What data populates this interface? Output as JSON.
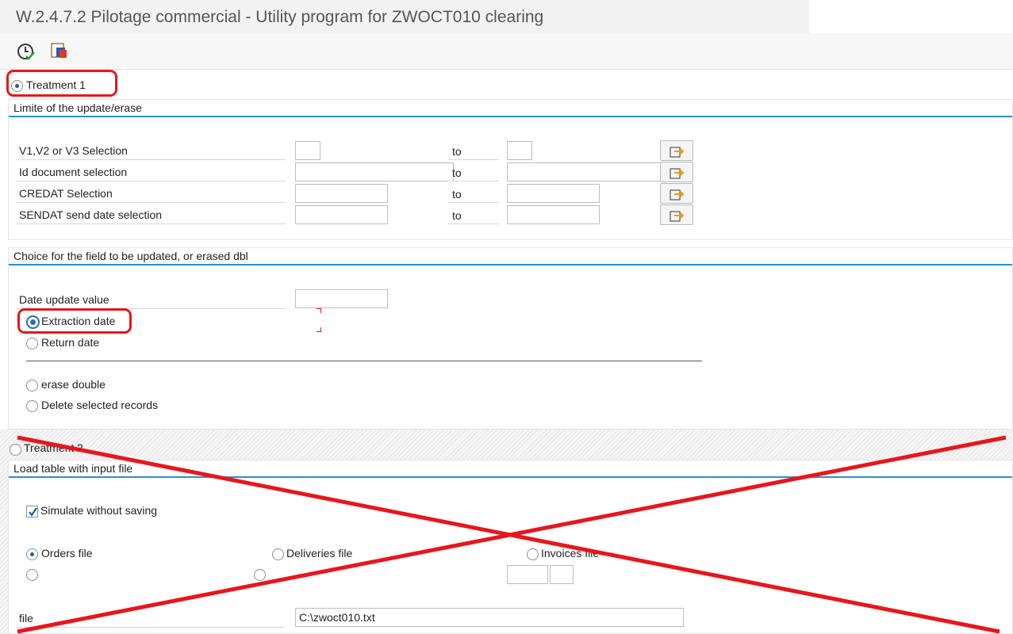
{
  "window": {
    "title": "W.2.4.7.2 Pilotage commercial - Utility program for ZWOCT010 clearing"
  },
  "toolbar": {
    "execute_icon": "execute-clock-icon",
    "variant_icon": "get-variant-icon"
  },
  "treatment1": {
    "label": "Treatment 1",
    "selected": true,
    "limits_frame": {
      "title": "Limite of the update/erase",
      "to_label": "to",
      "rows": [
        {
          "label": "V1,V2 or V3 Selection",
          "from": "",
          "to": ""
        },
        {
          "label": "Id document selection",
          "from": "",
          "to": ""
        },
        {
          "label": "CREDAT Selection",
          "from": "",
          "to": ""
        },
        {
          "label": "SENDAT send date selection",
          "from": "",
          "to": ""
        }
      ]
    },
    "choice_frame": {
      "title": "Choice for the field to be updated, or erased dbl",
      "date_update_label": "Date update value",
      "date_update_value": "",
      "extraction_label": "Extraction date",
      "extraction_selected": true,
      "return_label": "Return date",
      "erase_double_label": "erase double",
      "delete_selected_label": "Delete selected records"
    }
  },
  "treatment2": {
    "label": "Treatment 2",
    "selected": false,
    "load_frame": {
      "title": "Load table with input file",
      "simulate_label": "Simulate without saving",
      "simulate_checked": true,
      "orders_label": "Orders file",
      "deliveries_label": "Deliveries file",
      "invoices_label": "Invoices file",
      "file_label": "file",
      "file_value": "C:\\zwoct010.txt"
    }
  },
  "annotations": {
    "highlight_color": "#e8161b",
    "cross_color": "#e8161b"
  }
}
